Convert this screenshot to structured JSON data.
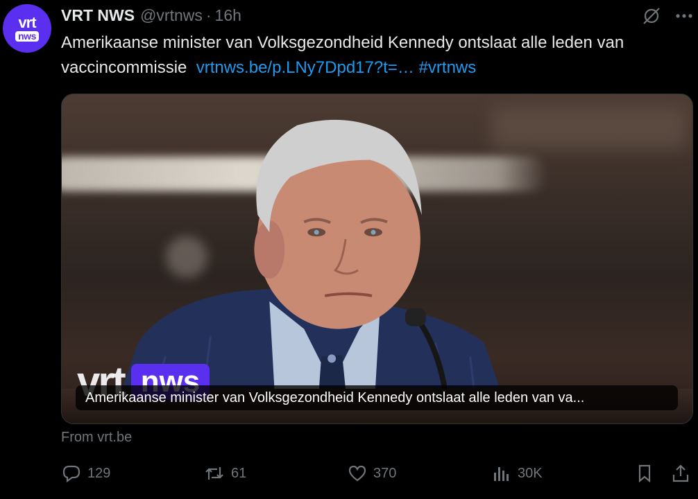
{
  "avatar": {
    "line1": "vrt",
    "line2": "nws"
  },
  "author": {
    "name": "VRT NWS",
    "handle": "@vrtnws",
    "separator": "·",
    "time": "16h"
  },
  "top_icons": [
    "grok-icon",
    "more-icon"
  ],
  "tweet": {
    "text": "Amerikaanse minister van Volksgezondheid Kennedy ontslaat alle leden van vaccincommissie",
    "link": "vrtnws.be/p.LNy7Dpd17?t=…",
    "hashtag": "#vrtnws"
  },
  "media": {
    "watermark_vrt": "vrt",
    "watermark_nws": "nws",
    "caption": "Amerikaanse minister van Volksgezondheid Kennedy ontslaat alle leden van va..."
  },
  "source": "From vrt.be",
  "actions": {
    "replies": "129",
    "reposts": "61",
    "likes": "370",
    "views": "30K"
  },
  "colors": {
    "accent": "#1d9bf0",
    "muted": "#71767b",
    "brand": "#5b2ff0",
    "background": "#000000"
  }
}
